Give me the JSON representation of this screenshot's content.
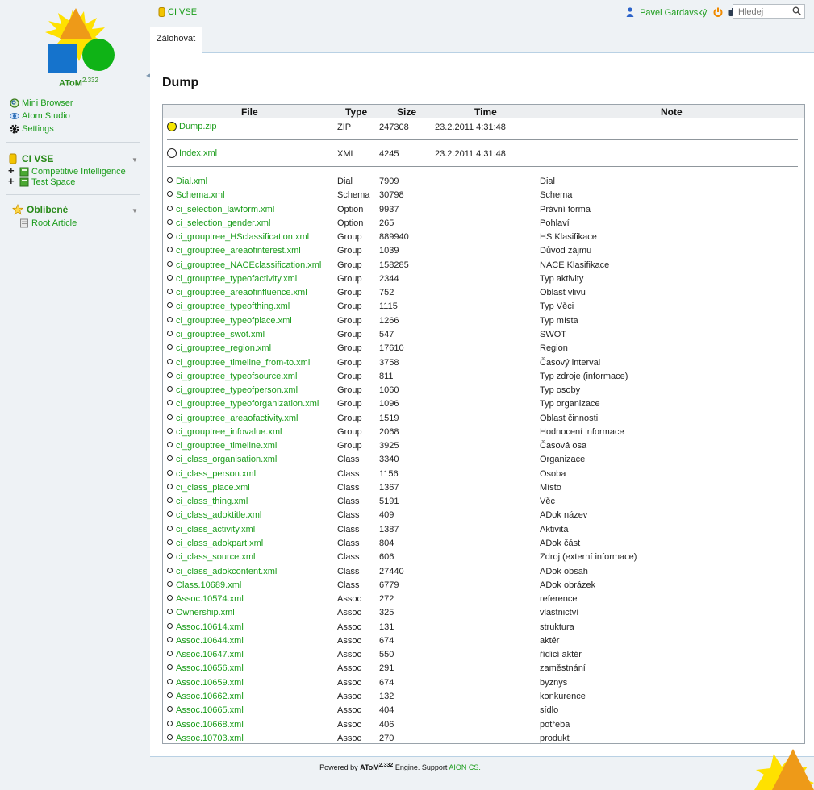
{
  "brand": {
    "name": "AToM",
    "version": "2.332",
    "accent": "#1a9c1a"
  },
  "sidebar": {
    "tools": [
      {
        "label": "Mini Browser",
        "icon": "magnifier-icon"
      },
      {
        "label": "Atom Studio",
        "icon": "eye-icon"
      },
      {
        "label": "Settings",
        "icon": "gear-icon"
      }
    ],
    "workspace": {
      "title": "CI VSE",
      "items": [
        {
          "label": "Competitive Intelligence"
        },
        {
          "label": "Test Space"
        }
      ]
    },
    "favorites": {
      "title": "Oblíbené",
      "items": [
        {
          "label": "Root Article"
        }
      ]
    }
  },
  "header": {
    "breadcrumb": "CI VSE",
    "user": "Pavel Gardavský",
    "search_placeholder": "Hledej"
  },
  "tabs": [
    {
      "label": "Zálohovat",
      "active": true
    }
  ],
  "page_title": "Dump",
  "table": {
    "columns": {
      "file": "File",
      "type": "Type",
      "size": "Size",
      "time": "Time",
      "note": "Note"
    },
    "top_files": [
      {
        "file": "Dump.zip",
        "type": "ZIP",
        "size": "247308",
        "time": "23.2.2011 4:31:48",
        "note": ""
      },
      {
        "file": "Index.xml",
        "type": "XML",
        "size": "4245",
        "time": "23.2.2011 4:31:48",
        "note": ""
      }
    ],
    "rows": [
      {
        "file": "Dial.xml",
        "type": "Dial",
        "size": "7909",
        "note": "Dial"
      },
      {
        "file": "Schema.xml",
        "type": "Schema",
        "size": "30798",
        "note": "Schema"
      },
      {
        "file": "ci_selection_lawform.xml",
        "type": "Option",
        "size": "9937",
        "note": "Právní forma"
      },
      {
        "file": "ci_selection_gender.xml",
        "type": "Option",
        "size": "265",
        "note": "Pohlaví"
      },
      {
        "file": "ci_grouptree_HSclassification.xml",
        "type": "Group",
        "size": "889940",
        "note": "HS Klasifikace"
      },
      {
        "file": "ci_grouptree_areaofinterest.xml",
        "type": "Group",
        "size": "1039",
        "note": "Důvod zájmu"
      },
      {
        "file": "ci_grouptree_NACEclassification.xml",
        "type": "Group",
        "size": "158285",
        "note": "NACE Klasifikace"
      },
      {
        "file": "ci_grouptree_typeofactivity.xml",
        "type": "Group",
        "size": "2344",
        "note": "Typ aktivity"
      },
      {
        "file": "ci_grouptree_areaofinfluence.xml",
        "type": "Group",
        "size": "752",
        "note": "Oblast vlivu"
      },
      {
        "file": "ci_grouptree_typeofthing.xml",
        "type": "Group",
        "size": "1115",
        "note": "Typ Věci"
      },
      {
        "file": "ci_grouptree_typeofplace.xml",
        "type": "Group",
        "size": "1266",
        "note": "Typ místa"
      },
      {
        "file": "ci_grouptree_swot.xml",
        "type": "Group",
        "size": "547",
        "note": "SWOT"
      },
      {
        "file": "ci_grouptree_region.xml",
        "type": "Group",
        "size": "17610",
        "note": "Region"
      },
      {
        "file": "ci_grouptree_timeline_from-to.xml",
        "type": "Group",
        "size": "3758",
        "note": "Časový interval"
      },
      {
        "file": "ci_grouptree_typeofsource.xml",
        "type": "Group",
        "size": "811",
        "note": "Typ zdroje (informace)"
      },
      {
        "file": "ci_grouptree_typeofperson.xml",
        "type": "Group",
        "size": "1060",
        "note": "Typ osoby"
      },
      {
        "file": "ci_grouptree_typeoforganization.xml",
        "type": "Group",
        "size": "1096",
        "note": "Typ organizace"
      },
      {
        "file": "ci_grouptree_areaofactivity.xml",
        "type": "Group",
        "size": "1519",
        "note": "Oblast činnosti"
      },
      {
        "file": "ci_grouptree_infovalue.xml",
        "type": "Group",
        "size": "2068",
        "note": "Hodnocení informace"
      },
      {
        "file": "ci_grouptree_timeline.xml",
        "type": "Group",
        "size": "3925",
        "note": "Časová osa"
      },
      {
        "file": "ci_class_organisation.xml",
        "type": "Class",
        "size": "3340",
        "note": "Organizace"
      },
      {
        "file": "ci_class_person.xml",
        "type": "Class",
        "size": "1156",
        "note": "Osoba"
      },
      {
        "file": "ci_class_place.xml",
        "type": "Class",
        "size": "1367",
        "note": "Místo"
      },
      {
        "file": "ci_class_thing.xml",
        "type": "Class",
        "size": "5191",
        "note": "Věc"
      },
      {
        "file": "ci_class_adoktitle.xml",
        "type": "Class",
        "size": "409",
        "note": "ADok název"
      },
      {
        "file": "ci_class_activity.xml",
        "type": "Class",
        "size": "1387",
        "note": "Aktivita"
      },
      {
        "file": "ci_class_adokpart.xml",
        "type": "Class",
        "size": "804",
        "note": "ADok část"
      },
      {
        "file": "ci_class_source.xml",
        "type": "Class",
        "size": "606",
        "note": "Zdroj (externí informace)"
      },
      {
        "file": "ci_class_adokcontent.xml",
        "type": "Class",
        "size": "27440",
        "note": "ADok obsah"
      },
      {
        "file": "Class.10689.xml",
        "type": "Class",
        "size": "6779",
        "note": "ADok obrázek"
      },
      {
        "file": "Assoc.10574.xml",
        "type": "Assoc",
        "size": "272",
        "note": "reference"
      },
      {
        "file": "Ownership.xml",
        "type": "Assoc",
        "size": "325",
        "note": "vlastnictví"
      },
      {
        "file": "Assoc.10614.xml",
        "type": "Assoc",
        "size": "131",
        "note": "struktura"
      },
      {
        "file": "Assoc.10644.xml",
        "type": "Assoc",
        "size": "674",
        "note": "aktér"
      },
      {
        "file": "Assoc.10647.xml",
        "type": "Assoc",
        "size": "550",
        "note": "řídící aktér"
      },
      {
        "file": "Assoc.10656.xml",
        "type": "Assoc",
        "size": "291",
        "note": "zaměstnání"
      },
      {
        "file": "Assoc.10659.xml",
        "type": "Assoc",
        "size": "674",
        "note": "byznys"
      },
      {
        "file": "Assoc.10662.xml",
        "type": "Assoc",
        "size": "132",
        "note": "konkurence"
      },
      {
        "file": "Assoc.10665.xml",
        "type": "Assoc",
        "size": "404",
        "note": "sídlo"
      },
      {
        "file": "Assoc.10668.xml",
        "type": "Assoc",
        "size": "406",
        "note": "potřeba"
      },
      {
        "file": "Assoc.10703.xml",
        "type": "Assoc",
        "size": "270",
        "note": "produkt"
      }
    ]
  },
  "footer": {
    "prefix": "Powered by",
    "engine_suffix": "Engine. Support",
    "support_link": "AION CS."
  }
}
